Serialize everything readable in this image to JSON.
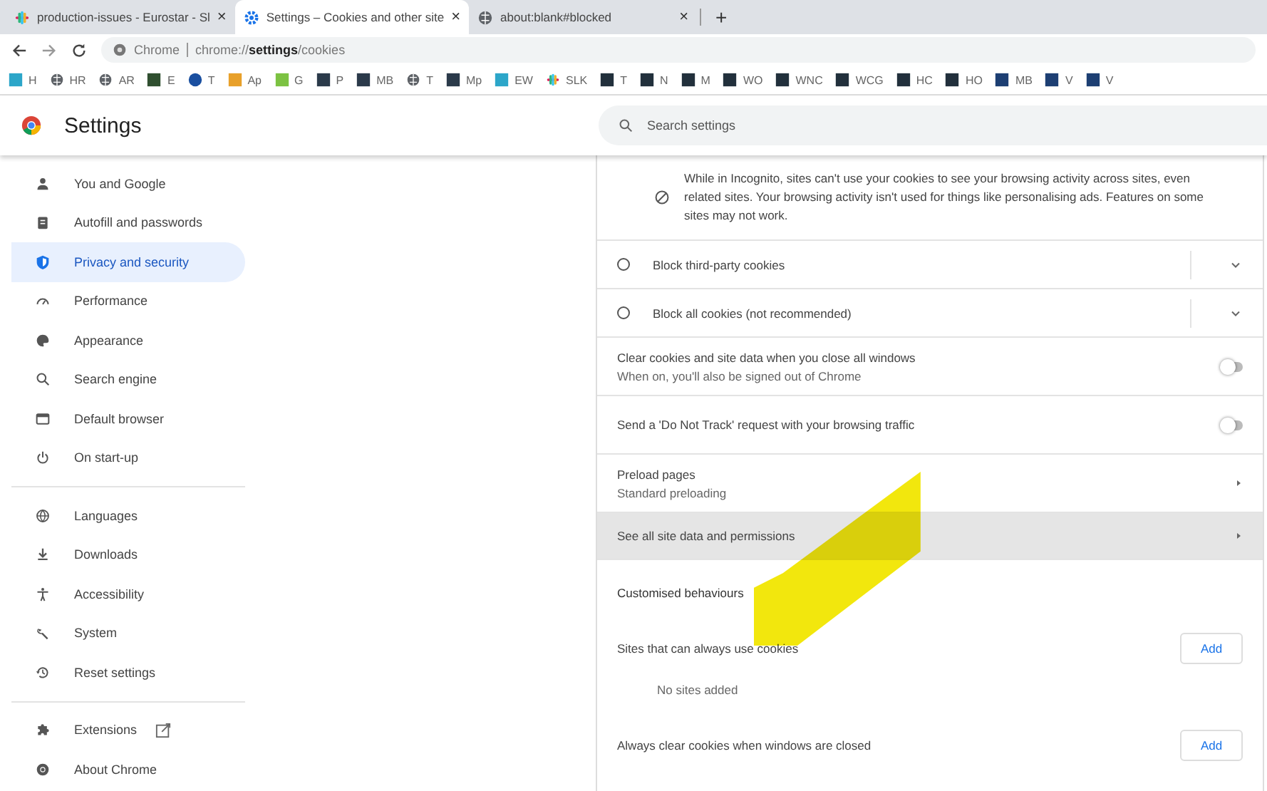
{
  "tabs": [
    {
      "title": "production-issues - Eurostar - Sl",
      "selected": false,
      "close": "×"
    },
    {
      "title": "Settings – Cookies and other site",
      "selected": true,
      "close": "×"
    },
    {
      "title": "about:blank#blocked",
      "selected": false,
      "close": "×"
    }
  ],
  "new_tab": "+",
  "address_bar": {
    "site_chip": "Chrome",
    "url": "chrome://**settings**/cookies"
  },
  "bookmarks": [
    {
      "label": "H",
      "kind": "tile",
      "color": "#2ca6c9"
    },
    {
      "label": "HR",
      "kind": "globe"
    },
    {
      "label": "AR",
      "kind": "globe"
    },
    {
      "label": "E",
      "kind": "tile",
      "color": "#2f4f2f"
    },
    {
      "label": "T",
      "kind": "circle",
      "color": "#1a4fa0"
    },
    {
      "label": "Ap",
      "kind": "tile",
      "color": "#e8a02a"
    },
    {
      "label": "G",
      "kind": "tile",
      "color": "#7cc242"
    },
    {
      "label": "P",
      "kind": "tile",
      "color": "#2b3a4a"
    },
    {
      "label": "MB",
      "kind": "tile",
      "color": "#2b3a4a"
    },
    {
      "label": "T",
      "kind": "globe"
    },
    {
      "label": "Mp",
      "kind": "tile",
      "color": "#2b3a4a"
    },
    {
      "label": "EW",
      "kind": "tile",
      "color": "#2ca6c9"
    },
    {
      "label": "SLK",
      "kind": "slack"
    },
    {
      "label": "T",
      "kind": "tile",
      "color": "#22303c"
    },
    {
      "label": "N",
      "kind": "tile",
      "color": "#22303c"
    },
    {
      "label": "M",
      "kind": "tile",
      "color": "#22303c"
    },
    {
      "label": "WO",
      "kind": "tile",
      "color": "#22303c"
    },
    {
      "label": "WNC",
      "kind": "tile",
      "color": "#22303c"
    },
    {
      "label": "WCG",
      "kind": "tile",
      "color": "#22303c"
    },
    {
      "label": "HC",
      "kind": "tile",
      "color": "#22303c"
    },
    {
      "label": "HO",
      "kind": "tile",
      "color": "#22303c"
    },
    {
      "label": "MB",
      "kind": "tile",
      "color": "#1d3f73"
    },
    {
      "label": "V",
      "kind": "tile",
      "color": "#1d3f73"
    },
    {
      "label": "V",
      "kind": "tile",
      "color": "#1d3f73"
    }
  ],
  "header": {
    "title": "Settings"
  },
  "search": {
    "placeholder": "Search settings"
  },
  "sidebar": {
    "groups": [
      [
        {
          "label": "You and Google",
          "selected": false
        },
        {
          "label": "Autofill and passwords",
          "selected": false
        },
        {
          "label": "Privacy and security",
          "selected": true
        },
        {
          "label": "Performance",
          "selected": false
        },
        {
          "label": "Appearance",
          "selected": false
        },
        {
          "label": "Search engine",
          "selected": false
        },
        {
          "label": "Default browser",
          "selected": false
        },
        {
          "label": "On start-up",
          "selected": false
        }
      ],
      [
        {
          "label": "Languages",
          "selected": false
        },
        {
          "label": "Downloads",
          "selected": false
        },
        {
          "label": "Accessibility",
          "selected": false
        },
        {
          "label": "System",
          "selected": false
        },
        {
          "label": "Reset settings",
          "selected": false
        }
      ],
      [
        {
          "label": "Extensions",
          "selected": false,
          "external": true
        },
        {
          "label": "About Chrome",
          "selected": false,
          "external": false
        }
      ]
    ]
  },
  "content": [
    {
      "kind": "note",
      "text": "While in Incognito, sites can't use your cookies to see your browsing activity across sites, even related sites. Your browsing activity isn't used for things like personalising ads. Features on some sites may not work."
    },
    {
      "kind": "radio",
      "label": "Block third-party cookies",
      "selected": false
    },
    {
      "kind": "radio",
      "label": "Block all cookies (not recommended)",
      "selected": false
    },
    {
      "kind": "toggle",
      "title": "Clear cookies and site data when you close all windows",
      "subtitle": "When on, you'll also be signed out of Chrome",
      "on": false
    },
    {
      "kind": "toggle",
      "title": "Send a 'Do Not Track' request with your browsing traffic",
      "on": false
    },
    {
      "kind": "link",
      "title": "Preload pages",
      "subtitle": "Standard preloading",
      "hovered": false
    },
    {
      "kind": "link",
      "title": "See all site data and permissions",
      "hovered": true
    },
    {
      "kind": "heading",
      "title": "Customised behaviours"
    },
    {
      "kind": "sites",
      "title": "Sites that can always use cookies",
      "button": "Add",
      "empty": "No sites added"
    },
    {
      "kind": "sites",
      "title": "Always clear cookies when windows are closed",
      "button": "Add"
    }
  ]
}
